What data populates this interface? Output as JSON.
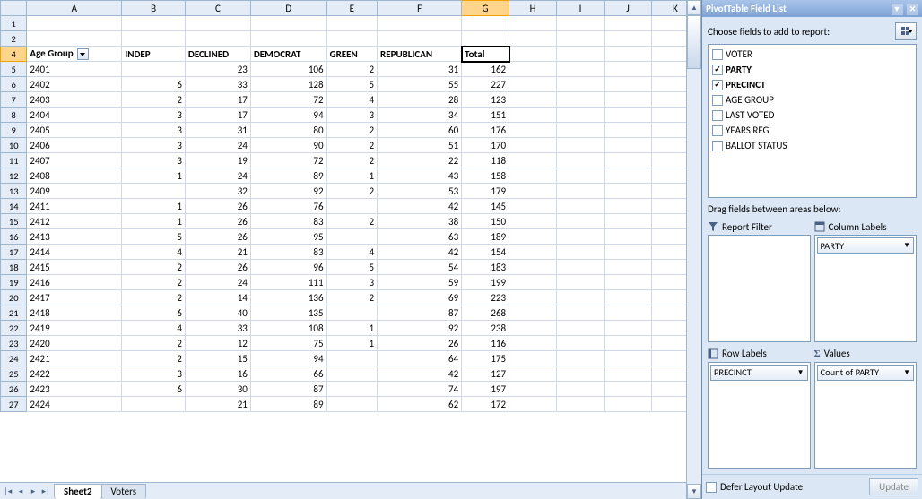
{
  "columns": [
    "A",
    "B",
    "C",
    "D",
    "E",
    "F",
    "G",
    "H",
    "I",
    "J",
    "K"
  ],
  "visible_rows_start": 1,
  "visible_rows": [
    1,
    2,
    4,
    5,
    6,
    7,
    8,
    9,
    10,
    11,
    12,
    13,
    14,
    15,
    16,
    17,
    18,
    19,
    20,
    21,
    22,
    23,
    24,
    25,
    26,
    27
  ],
  "headers": {
    "A": "Age Group",
    "B": "INDEP",
    "C": "DECLINED",
    "D": "DEMOCRAT",
    "E": "GREEN",
    "F": "REPUBLICAN",
    "G": "Total"
  },
  "active_cell": "G4",
  "rows": [
    {
      "r": 5,
      "A": "2401",
      "B": "",
      "C": "23",
      "D": "106",
      "E": "2",
      "F": "31",
      "G": "162"
    },
    {
      "r": 6,
      "A": "2402",
      "B": "6",
      "C": "33",
      "D": "128",
      "E": "5",
      "F": "55",
      "G": "227"
    },
    {
      "r": 7,
      "A": "2403",
      "B": "2",
      "C": "17",
      "D": "72",
      "E": "4",
      "F": "28",
      "G": "123"
    },
    {
      "r": 8,
      "A": "2404",
      "B": "3",
      "C": "17",
      "D": "94",
      "E": "3",
      "F": "34",
      "G": "151"
    },
    {
      "r": 9,
      "A": "2405",
      "B": "3",
      "C": "31",
      "D": "80",
      "E": "2",
      "F": "60",
      "G": "176"
    },
    {
      "r": 10,
      "A": "2406",
      "B": "3",
      "C": "24",
      "D": "90",
      "E": "2",
      "F": "51",
      "G": "170"
    },
    {
      "r": 11,
      "A": "2407",
      "B": "3",
      "C": "19",
      "D": "72",
      "E": "2",
      "F": "22",
      "G": "118"
    },
    {
      "r": 12,
      "A": "2408",
      "B": "1",
      "C": "24",
      "D": "89",
      "E": "1",
      "F": "43",
      "G": "158"
    },
    {
      "r": 13,
      "A": "2409",
      "B": "",
      "C": "32",
      "D": "92",
      "E": "2",
      "F": "53",
      "G": "179"
    },
    {
      "r": 14,
      "A": "2411",
      "B": "1",
      "C": "26",
      "D": "76",
      "E": "",
      "F": "42",
      "G": "145"
    },
    {
      "r": 15,
      "A": "2412",
      "B": "1",
      "C": "26",
      "D": "83",
      "E": "2",
      "F": "38",
      "G": "150"
    },
    {
      "r": 16,
      "A": "2413",
      "B": "5",
      "C": "26",
      "D": "95",
      "E": "",
      "F": "63",
      "G": "189"
    },
    {
      "r": 17,
      "A": "2414",
      "B": "4",
      "C": "21",
      "D": "83",
      "E": "4",
      "F": "42",
      "G": "154"
    },
    {
      "r": 18,
      "A": "2415",
      "B": "2",
      "C": "26",
      "D": "96",
      "E": "5",
      "F": "54",
      "G": "183"
    },
    {
      "r": 19,
      "A": "2416",
      "B": "2",
      "C": "24",
      "D": "111",
      "E": "3",
      "F": "59",
      "G": "199"
    },
    {
      "r": 20,
      "A": "2417",
      "B": "2",
      "C": "14",
      "D": "136",
      "E": "2",
      "F": "69",
      "G": "223"
    },
    {
      "r": 21,
      "A": "2418",
      "B": "6",
      "C": "40",
      "D": "135",
      "E": "",
      "F": "87",
      "G": "268"
    },
    {
      "r": 22,
      "A": "2419",
      "B": "4",
      "C": "33",
      "D": "108",
      "E": "1",
      "F": "92",
      "G": "238"
    },
    {
      "r": 23,
      "A": "2420",
      "B": "2",
      "C": "12",
      "D": "75",
      "E": "1",
      "F": "26",
      "G": "116"
    },
    {
      "r": 24,
      "A": "2421",
      "B": "2",
      "C": "15",
      "D": "94",
      "E": "",
      "F": "64",
      "G": "175"
    },
    {
      "r": 25,
      "A": "2422",
      "B": "3",
      "C": "16",
      "D": "66",
      "E": "",
      "F": "42",
      "G": "127"
    },
    {
      "r": 26,
      "A": "2423",
      "B": "6",
      "C": "30",
      "D": "87",
      "E": "",
      "F": "74",
      "G": "197"
    },
    {
      "r": 27,
      "A": "2424",
      "B": "",
      "C": "21",
      "D": "89",
      "E": "",
      "F": "62",
      "G": "172"
    }
  ],
  "sheet_tabs": {
    "active": "Sheet2",
    "other": "Voters"
  },
  "pane": {
    "title": "PivotTable Field List",
    "choose_label": "Choose fields to add to report:",
    "fields": [
      {
        "name": "VOTER",
        "checked": false
      },
      {
        "name": "PARTY",
        "checked": true
      },
      {
        "name": "PRECINCT",
        "checked": true
      },
      {
        "name": "AGE GROUP",
        "checked": false
      },
      {
        "name": "LAST VOTED",
        "checked": false
      },
      {
        "name": "YEARS REG",
        "checked": false
      },
      {
        "name": "BALLOT STATUS",
        "checked": false
      }
    ],
    "drag_label": "Drag fields between areas below:",
    "areas": {
      "report_filter": {
        "label": "Report Filter",
        "items": []
      },
      "column_labels": {
        "label": "Column Labels",
        "items": [
          "PARTY"
        ]
      },
      "row_labels": {
        "label": "Row Labels",
        "items": [
          "PRECINCT"
        ]
      },
      "values": {
        "label": "Values",
        "items": [
          "Count of PARTY"
        ]
      }
    },
    "defer_label": "Defer Layout Update",
    "update_label": "Update"
  }
}
